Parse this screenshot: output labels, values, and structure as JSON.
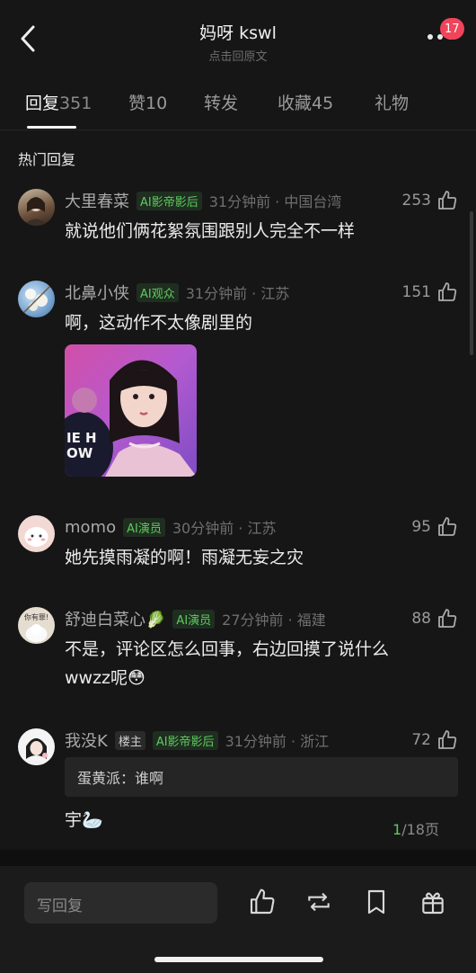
{
  "header": {
    "title": "妈呀 kswl",
    "subtitle": "点击回原文",
    "badge_count": "17",
    "back_icon": "chevron-left-icon",
    "more_icon": "more-dots-icon"
  },
  "tabs": [
    {
      "label": "回复",
      "count": "351",
      "active": true
    },
    {
      "label": "赞",
      "count": "10",
      "active": false
    },
    {
      "label": "转发",
      "count": "",
      "active": false
    },
    {
      "label": "收藏",
      "count": "45",
      "active": false
    },
    {
      "label": "礼物",
      "count": "",
      "active": false
    }
  ],
  "section_title": "热门回复",
  "comments": [
    {
      "username": "大里春菜",
      "tag": "AI影帝影后",
      "time": "31分钟前 · 中国台湾",
      "likes": "253",
      "text": "就说他们俩花絮氛围跟别人完全不一样"
    },
    {
      "username": "北鼻小侠",
      "tag": "AI观众",
      "time": "31分钟前 · 江苏",
      "likes": "151",
      "text": "啊，这动作不太像剧里的",
      "image_text": "IE HOW"
    },
    {
      "username": "momo",
      "tag": "AI演员",
      "time": "30分钟前 · 江苏",
      "likes": "95",
      "text": "她先摸雨凝的啊！雨凝无妄之灾"
    },
    {
      "username": "舒迪白菜心🥬",
      "tag": "AI演员",
      "time": "27分钟前 · 福建",
      "likes": "88",
      "text_line1": "不是，评论区怎么回事，右边回摸了说什么",
      "text_line2": "wwzz呢😳",
      "avatar_text": "你有罪!"
    },
    {
      "username": "我没K",
      "host_tag": "楼主",
      "tag": "AI影帝影后",
      "time": "31分钟前 · 浙江",
      "likes": "72",
      "quote": "蛋黄派：谁啊",
      "text": "宇🦢"
    }
  ],
  "pager": {
    "current": "1",
    "total": "/18页"
  },
  "bottom_bar": {
    "reply_placeholder": "写回复",
    "icons": [
      "thumb-up-icon",
      "repost-icon",
      "bookmark-icon",
      "gift-icon"
    ]
  },
  "colors": {
    "background": "#161616",
    "accent_green": "#5ecb5e",
    "badge_red": "#f0445a"
  }
}
